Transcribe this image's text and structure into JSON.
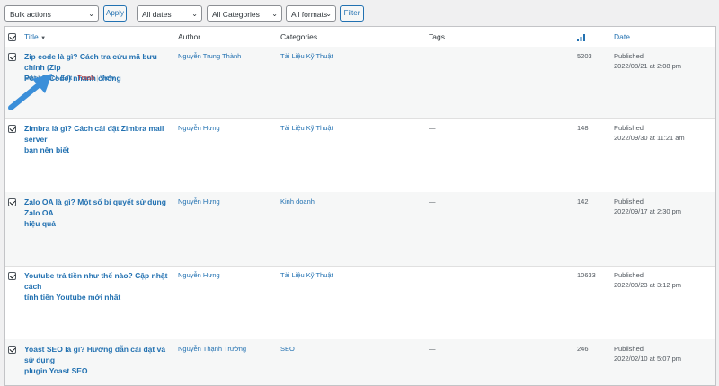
{
  "toolbar": {
    "bulk_actions": "Bulk actions",
    "apply": "Apply",
    "dates": "All dates",
    "categories": "All Categories",
    "formats": "All formats",
    "filter": "Filter"
  },
  "columns": {
    "title": "Title",
    "author": "Author",
    "categories": "Categories",
    "tags": "Tags",
    "date": "Date"
  },
  "row_actions": {
    "edit": "Edit",
    "quick_edit": "Quick Edit",
    "trash": "Trash",
    "view": "View",
    "separator": "|"
  },
  "posts": [
    {
      "title_line1": "Zip code là gì? Cách tra cứu mã bưu chính (Zip",
      "title_line2": "Postal Code) nhanh chóng",
      "author": "Nguyễn Trung Thành",
      "category": "Tài Liệu Kỹ Thuật",
      "tags": "—",
      "views": "5203",
      "status": "Published",
      "date": "2022/08/21 at 2:08 pm"
    },
    {
      "title_line1": "Zimbra là gì? Cách cài đặt Zimbra mail server",
      "title_line2": "bạn nên biết",
      "author": "Nguyễn Hưng",
      "category": "Tài Liệu Kỹ Thuật",
      "tags": "—",
      "views": "148",
      "status": "Published",
      "date": "2022/09/30 at 11:21 am"
    },
    {
      "title_line1": "Zalo OA là gì? Một số bí quyết sử dụng Zalo OA",
      "title_line2": "hiệu quả",
      "author": "Nguyễn Hưng",
      "category": "Kinh doanh",
      "tags": "—",
      "views": "142",
      "status": "Published",
      "date": "2022/09/17 at 2:30 pm"
    },
    {
      "title_line1": "Youtube trả tiền như thế nào? Cập nhật cách",
      "title_line2": "tính tiền Youtube mới nhất",
      "author": "Nguyễn Hưng",
      "category": "Tài Liệu Kỹ Thuật",
      "tags": "—",
      "views": "10633",
      "status": "Published",
      "date": "2022/08/23 at 3:12 pm"
    },
    {
      "title_line1": "Yoast SEO là gì? Hướng dẫn cài đặt và sử dụng",
      "title_line2": "plugin Yoast SEO",
      "author": "Nguyễn Thạnh Trường",
      "category": "SEO",
      "tags": "—",
      "views": "246",
      "status": "Published",
      "date": "2022/02/10 at 5:07 pm"
    }
  ],
  "colors": {
    "link": "#2271b1",
    "trash": "#b32d2e",
    "arrow": "#3b8fd9"
  }
}
